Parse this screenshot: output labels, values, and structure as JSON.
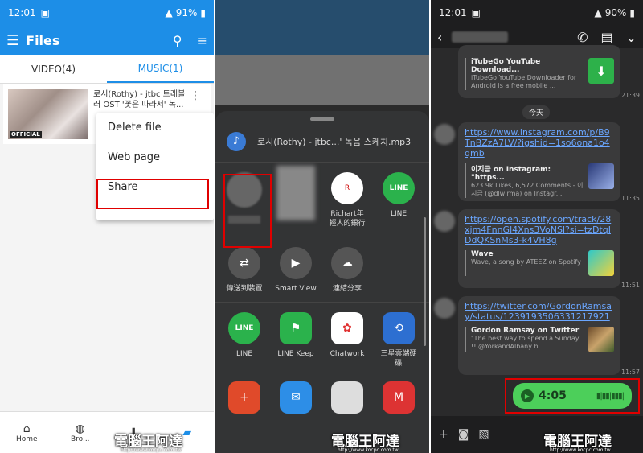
{
  "panel1": {
    "status": {
      "time": "12:01",
      "battery": "91%"
    },
    "appbar": {
      "title": "Files"
    },
    "tabs": [
      {
        "label": "VIDEO(4)"
      },
      {
        "label": "MUSIC(1)"
      }
    ],
    "file": {
      "name": "로시(Rothy) - jtbc 트래블러 OST '꽃은 따라서' 녹...",
      "thumb_badge": "OFFICIAL"
    },
    "menu": [
      "Delete file",
      "Web page",
      "Share"
    ],
    "bottomnav": [
      "Home",
      "Bro..."
    ]
  },
  "panel2": {
    "file_name": "로시(Rothy) - jtbc...' 녹음 스케치.mp3",
    "row1": [
      {
        "label": "",
        "color": "#666666"
      },
      {
        "label": "",
        "color": "#888888"
      },
      {
        "label": "Richart年輕人的銀行",
        "color": "#ffffff"
      },
      {
        "label": "LINE",
        "color": "#2bb24c"
      }
    ],
    "row2": [
      {
        "label": "傳送到裝置",
        "color": "#555555"
      },
      {
        "label": "Smart View",
        "color": "#555555"
      },
      {
        "label": "連結分享",
        "color": "#555555"
      }
    ],
    "row3": [
      {
        "label": "LINE",
        "color": "#2bb24c"
      },
      {
        "label": "LINE Keep",
        "color": "#2bb24c"
      },
      {
        "label": "Chatwork",
        "color": "#ffffff"
      },
      {
        "label": "三星雲端硬碟",
        "color": "#2d6fd1"
      }
    ]
  },
  "panel3": {
    "status": {
      "time": "12:01",
      "battery": "90%"
    },
    "date_chip": "今天",
    "messages": [
      {
        "preview_title": "iTubeGo YouTube Download...",
        "preview_desc": "iTubeGo YouTube Downloader for Android is a free mobile ...",
        "time": "21:39"
      },
      {
        "link": "https://www.instagram.com/p/B9TnBZzA7LV/?igshid=1so6ona1o4qmb",
        "preview_title": "이지금 on Instagram: \"https...",
        "preview_desc": "623.9k Likes, 6,572 Comments - 이지금 (@dlwlrma) on Instagr...",
        "time": "11:35"
      },
      {
        "link": "https://open.spotify.com/track/28xjm4FnnGl4Xns3VoNSl?si=tzDtqIDdQKSnMs3-k4VH8g",
        "preview_title": "Wave",
        "preview_desc": "Wave, a song by ATEEZ on Spotify",
        "time": "11:51"
      },
      {
        "link": "https://twitter.com/GordonRamsay/status/1239193506331217921",
        "preview_title": "Gordon Ramsay on Twitter",
        "preview_desc": "\"The best way to spend a Sunday !! @YorkandAlbany h...",
        "time": "11:57"
      }
    ],
    "voice": {
      "duration": "4:05"
    }
  },
  "watermark": {
    "text": "電腦王阿達",
    "url": "http://www.kocpc.com.tw"
  }
}
